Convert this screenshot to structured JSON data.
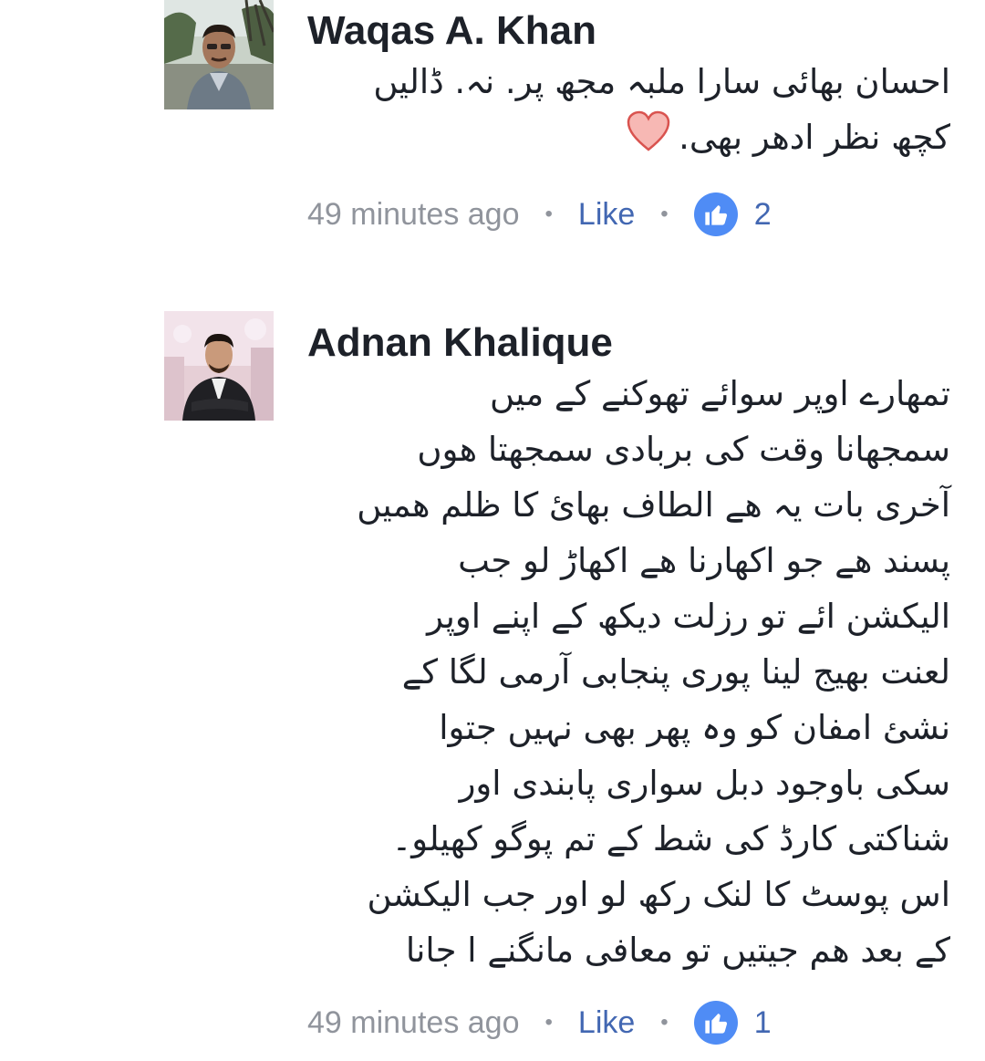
{
  "comments": [
    {
      "author": "Waqas A. Khan",
      "body_lines": [
        "احسان بھائی سارا ملبہ مجھ پر. نہ. ڈالیں",
        "کچھ نظر ادھر بھی."
      ],
      "emoji": "heart-icon",
      "time": "49 minutes ago",
      "like_label": "Like",
      "like_count": "2"
    },
    {
      "author": "Adnan Khalique",
      "body_lines": [
        "تمھارے اوپر سوائے تھوکنے کے میں",
        "سمجھانا وقت کی بربادی سمجھتا ھوں",
        "آخری بات یہ ھے الطاف بھائ کا ظلم ھمیں",
        "پسند ھے جو اکھارنا ھے اکھاڑ لو جب",
        "الیکشن ائے تو رزلت دیکھ کے اپنے اوپر",
        "لعنت بھیج لینا پوری پنجابی آرمی لگا کے",
        "نشئ امفان کو وہ پھر بھی نہیں جتوا",
        "سکی باوجود دبل سواری پابندی اور",
        "شناکتی کارڈ کی شط کے تم پوگو کھیلو۔",
        "اس پوسٹ کا لنک رکھ لو اور جب الیکشن",
        "کے بعد ھم جیتیں تو معافی مانگنے ا جانا"
      ],
      "time": "49 minutes ago",
      "like_label": "Like",
      "like_count": "1"
    }
  ],
  "icons": {
    "reaction": "thumbs-up-icon",
    "reaction_color": "#4f8cf5",
    "link_color": "#4267b2",
    "meta_color": "#90949c"
  }
}
